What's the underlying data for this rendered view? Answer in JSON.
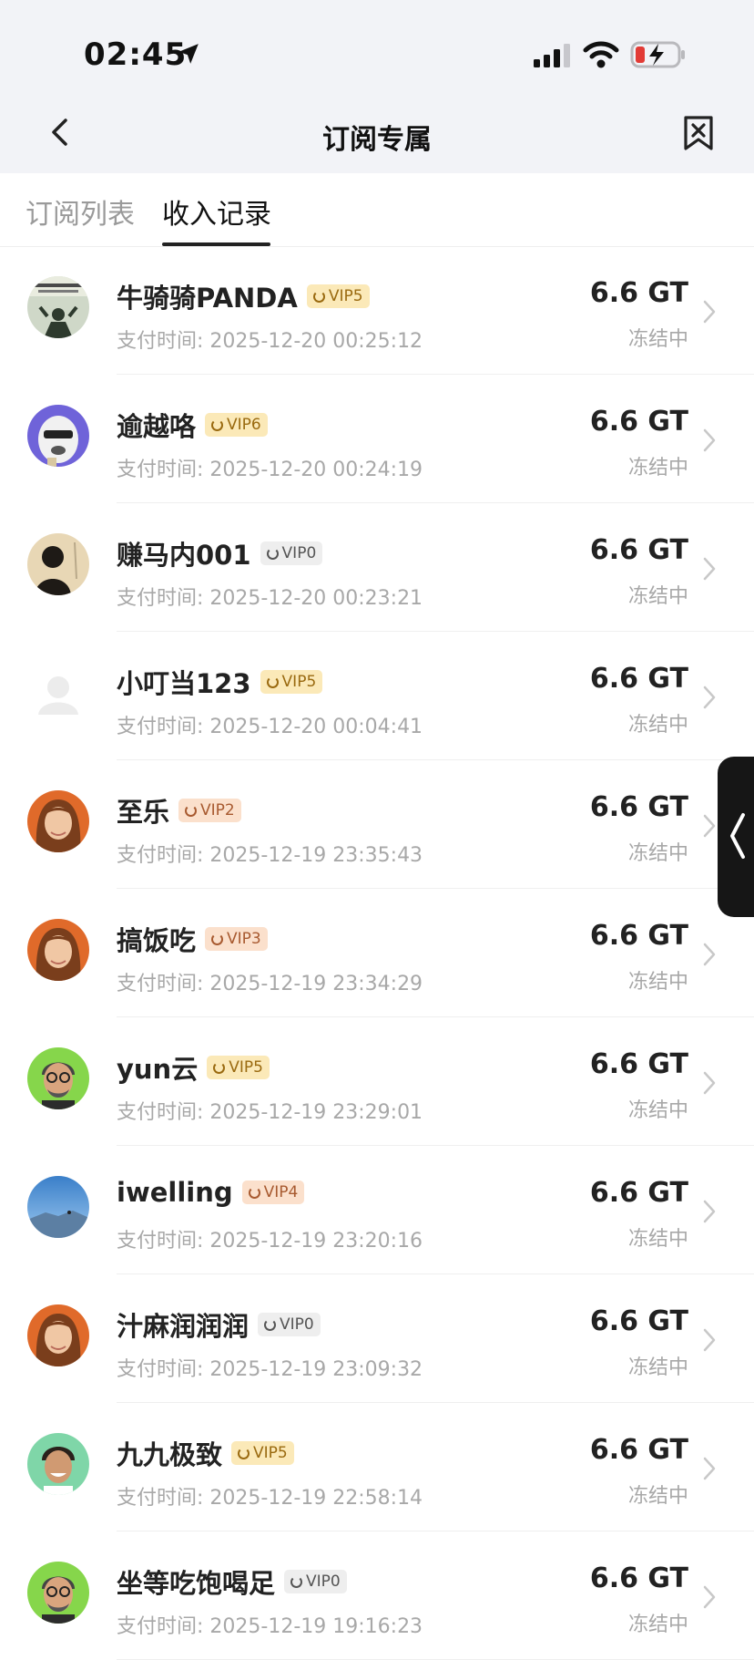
{
  "status_bar": {
    "time": "02:45"
  },
  "nav": {
    "title": "订阅专属"
  },
  "tabs": [
    {
      "label": "订阅列表"
    },
    {
      "label": "收入记录"
    }
  ],
  "records": [
    {
      "name": "牛骑骑PANDA",
      "vip": "VIP5",
      "tier": "gold",
      "time": "支付时间: 2025-12-20 00:25:12",
      "amount": "6.6 GT",
      "status": "冻结中",
      "avatar": "poster-avatar"
    },
    {
      "name": "逾越咯",
      "vip": "VIP6",
      "tier": "gold",
      "time": "支付时间: 2025-12-20 00:24:19",
      "amount": "6.6 GT",
      "status": "冻结中",
      "avatar": "dog-avatar"
    },
    {
      "name": "赚马内001",
      "vip": "VIP0",
      "tier": "gray",
      "time": "支付时间: 2025-12-20 00:23:21",
      "amount": "6.6 GT",
      "status": "冻结中",
      "avatar": "silhouette-avatar"
    },
    {
      "name": "小叮当123",
      "vip": "VIP5",
      "tier": "gold",
      "time": "支付时间: 2025-12-20 00:04:41",
      "amount": "6.6 GT",
      "status": "冻结中",
      "avatar": "default-avatar"
    },
    {
      "name": "至乐",
      "vip": "VIP2",
      "tier": "peach",
      "time": "支付时间: 2025-12-19 23:35:43",
      "amount": "6.6 GT",
      "status": "冻结中",
      "avatar": "woman-avatar"
    },
    {
      "name": "搞饭吃",
      "vip": "VIP3",
      "tier": "peach",
      "time": "支付时间: 2025-12-19 23:34:29",
      "amount": "6.6 GT",
      "status": "冻结中",
      "avatar": "woman-avatar"
    },
    {
      "name": "yun云",
      "vip": "VIP5",
      "tier": "gold",
      "time": "支付时间: 2025-12-19 23:29:01",
      "amount": "6.6 GT",
      "status": "冻结中",
      "avatar": "man-glasses-avatar"
    },
    {
      "name": "iwelling",
      "vip": "VIP4",
      "tier": "peach",
      "time": "支付时间: 2025-12-19 23:20:16",
      "amount": "6.6 GT",
      "status": "冻结中",
      "avatar": "sky-avatar"
    },
    {
      "name": "汁麻润润润",
      "vip": "VIP0",
      "tier": "gray",
      "time": "支付时间: 2025-12-19 23:09:32",
      "amount": "6.6 GT",
      "status": "冻结中",
      "avatar": "woman-avatar"
    },
    {
      "name": "九九极致",
      "vip": "VIP5",
      "tier": "gold",
      "time": "支付时间: 2025-12-19 22:58:14",
      "amount": "6.6 GT",
      "status": "冻结中",
      "avatar": "smiling-man-avatar"
    },
    {
      "name": "坐等吃饱喝足",
      "vip": "VIP0",
      "tier": "gray",
      "time": "支付时间: 2025-12-19 19:16:23",
      "amount": "6.6 GT",
      "status": "冻结中",
      "avatar": "man-glasses-avatar"
    }
  ],
  "colors": {
    "gold_bg": "#fbe9b8",
    "gold_fg": "#9a6a10",
    "peach_bg": "#fbe0cc",
    "peach_fg": "#a85a30",
    "gray_bg": "#eeeeee",
    "gray_fg": "#555555"
  }
}
